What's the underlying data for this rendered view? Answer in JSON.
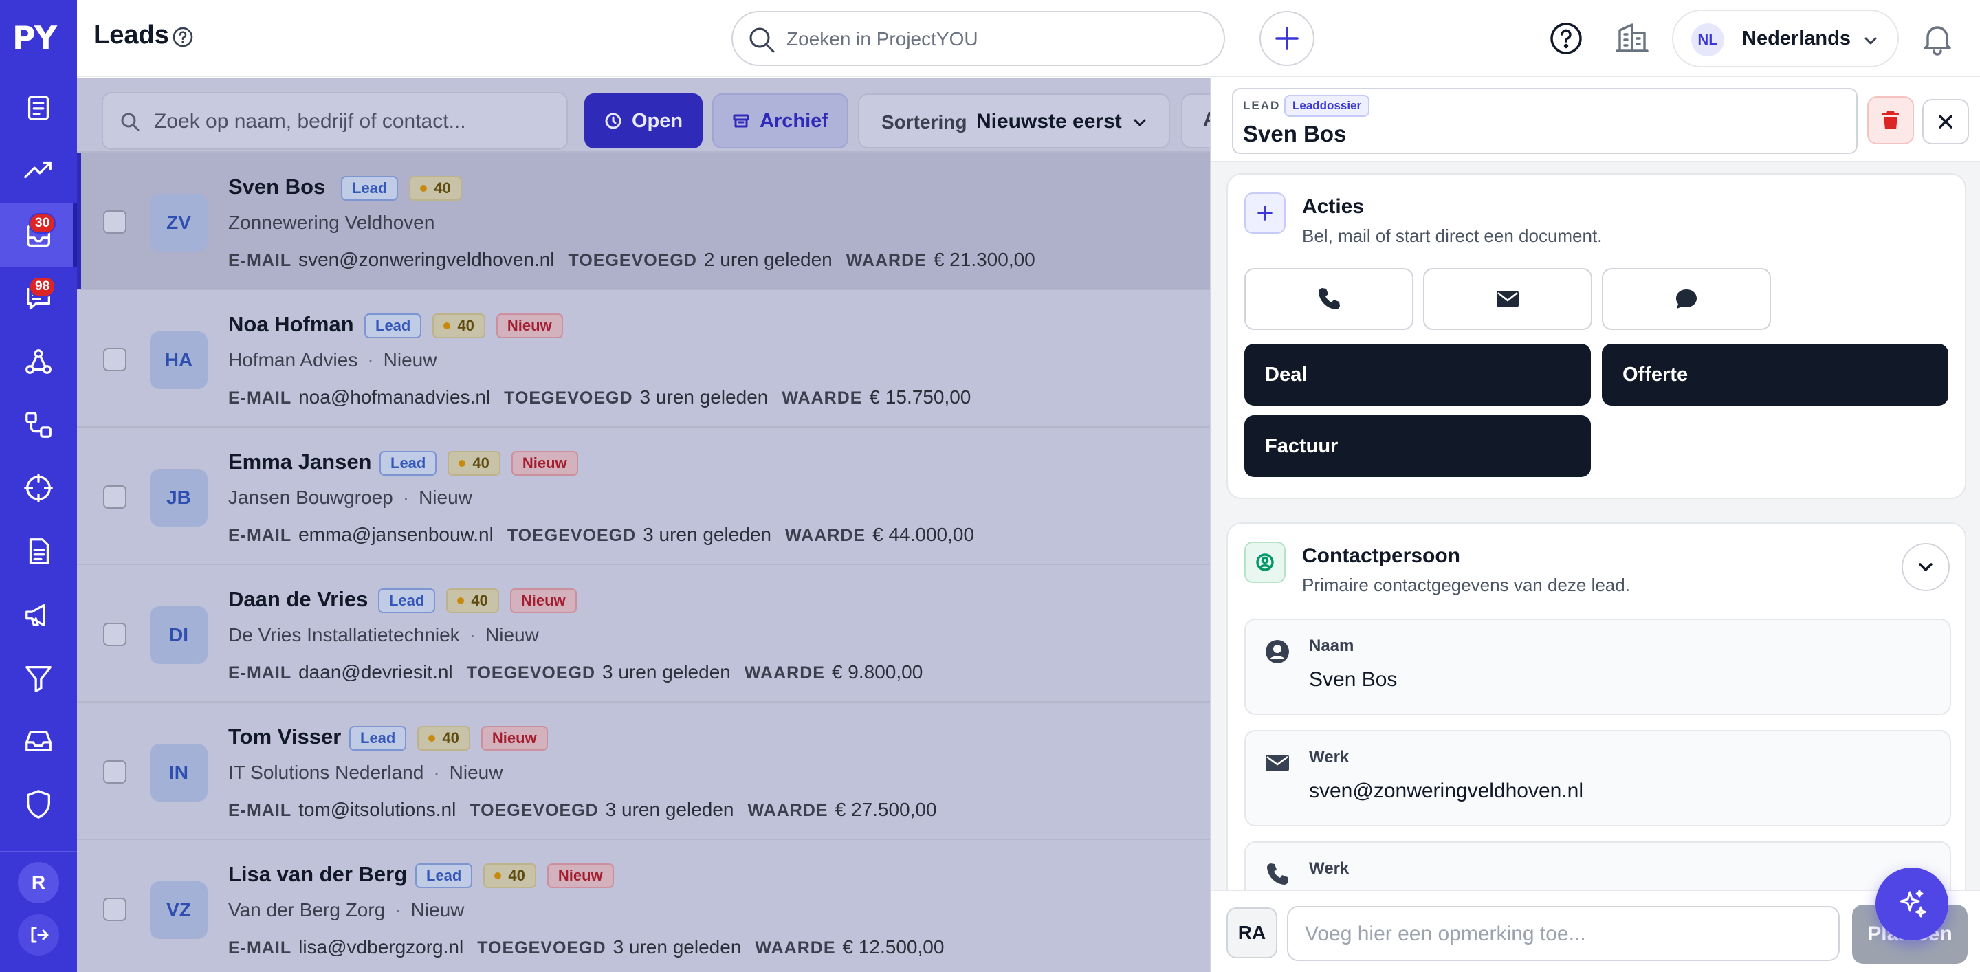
{
  "app": {
    "logo": "PY"
  },
  "sidebar": {
    "items": [
      {
        "icon": "clipboard-icon",
        "badge": ""
      },
      {
        "icon": "trending-up-icon",
        "badge": ""
      },
      {
        "icon": "leads-inbox-icon",
        "badge": "30",
        "active": true
      },
      {
        "icon": "chat-icon",
        "badge": "98"
      },
      {
        "icon": "network-icon",
        "badge": ""
      },
      {
        "icon": "workflow-icon",
        "badge": ""
      },
      {
        "icon": "target-icon",
        "badge": ""
      },
      {
        "icon": "document-icon",
        "badge": ""
      },
      {
        "icon": "megaphone-icon",
        "badge": ""
      },
      {
        "icon": "filter-icon",
        "badge": ""
      },
      {
        "icon": "inbox-tray-icon",
        "badge": ""
      },
      {
        "icon": "shield-icon",
        "badge": ""
      }
    ],
    "user_initial": "R"
  },
  "header": {
    "title": "Leads",
    "search_placeholder": "Zoeken in ProjectYOU",
    "language_code": "NL",
    "language_name": "Nederlands"
  },
  "list": {
    "search_placeholder": "Zoek op naam, bedrijf of contact...",
    "filters": {
      "open": "Open",
      "archive": "Archief"
    },
    "sort_label": "Sortering",
    "sort_value": "Nieuwste eerst",
    "extra_filter_partial": "A",
    "labels": {
      "email": "E-MAIL",
      "added": "TOEGEVOEGD",
      "value": "WAARDE"
    },
    "rows": [
      {
        "initials": "ZV",
        "name": "Sven Bos",
        "type": "Lead",
        "score": "40",
        "status": "",
        "company": "Zonnewering Veldhoven",
        "sub_status": "",
        "email": "sven@zonweringveldhoven.nl",
        "added": "2 uren geleden",
        "value": "€ 21.300,00"
      },
      {
        "initials": "HA",
        "name": "Noa Hofman",
        "type": "Lead",
        "score": "40",
        "status": "Nieuw",
        "company": "Hofman Advies",
        "sub_status": "Nieuw",
        "email": "noa@hofmanadvies.nl",
        "added": "3 uren geleden",
        "value": "€ 15.750,00"
      },
      {
        "initials": "JB",
        "name": "Emma Jansen",
        "type": "Lead",
        "score": "40",
        "status": "Nieuw",
        "company": "Jansen Bouwgroep",
        "sub_status": "Nieuw",
        "email": "emma@jansenbouw.nl",
        "added": "3 uren geleden",
        "value": "€ 44.000,00"
      },
      {
        "initials": "DI",
        "name": "Daan de Vries",
        "type": "Lead",
        "score": "40",
        "status": "Nieuw",
        "company": "De Vries Installatietechniek",
        "sub_status": "Nieuw",
        "email": "daan@devriesit.nl",
        "added": "3 uren geleden",
        "value": "€ 9.800,00"
      },
      {
        "initials": "IN",
        "name": "Tom Visser",
        "type": "Lead",
        "score": "40",
        "status": "Nieuw",
        "company": "IT Solutions Nederland",
        "sub_status": "Nieuw",
        "email": "tom@itsolutions.nl",
        "added": "3 uren geleden",
        "value": "€ 27.500,00"
      },
      {
        "initials": "VZ",
        "name": "Lisa van der Berg",
        "type": "Lead",
        "score": "40",
        "status": "Nieuw",
        "company": "Van der Berg Zorg",
        "sub_status": "Nieuw",
        "email": "lisa@vdbergzorg.nl",
        "added": "3 uren geleden",
        "value": "€ 12.500,00"
      }
    ]
  },
  "drawer": {
    "tag": "LEAD",
    "tag2": "Leaddossier",
    "name": "Sven Bos",
    "actions": {
      "title": "Acties",
      "subtitle": "Bel, mail of start direct een document.",
      "deal": "Deal",
      "quote": "Offerte",
      "invoice": "Factuur"
    },
    "contact": {
      "title": "Contactpersoon",
      "subtitle": "Primaire contactgegevens van deze lead.",
      "fields": [
        {
          "label": "Naam",
          "value": "Sven Bos"
        },
        {
          "label": "Werk",
          "value": "sven@zonweringveldhoven.nl"
        },
        {
          "label": "Werk",
          "value": ""
        }
      ]
    },
    "comment": {
      "avatar": "RA",
      "placeholder": "Voeg hier een opmerking toe...",
      "submit": "Plaatsen"
    }
  },
  "colors": {
    "sidebar": "#3b37d6",
    "accent": "#2f2ab7",
    "dark_button": "#111827",
    "danger": "#dc2626"
  }
}
